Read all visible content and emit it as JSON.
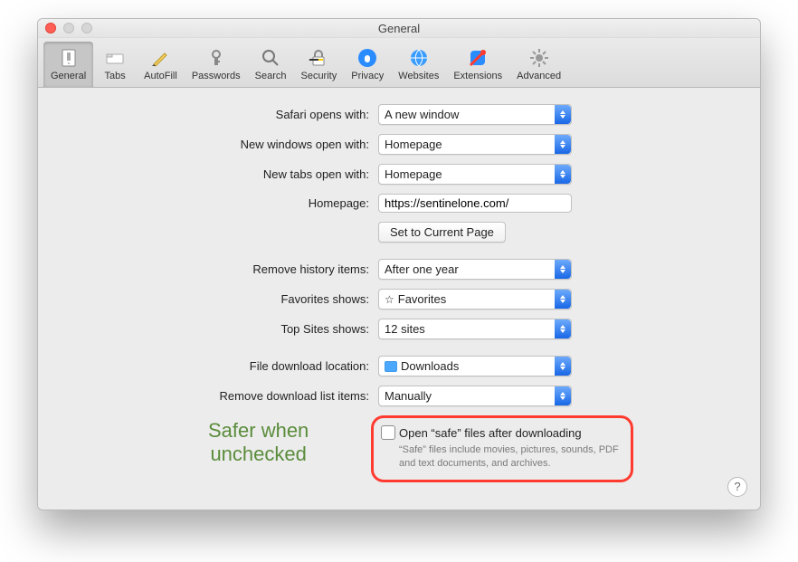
{
  "window": {
    "title": "General"
  },
  "toolbar": {
    "items": [
      {
        "label": "General"
      },
      {
        "label": "Tabs"
      },
      {
        "label": "AutoFill"
      },
      {
        "label": "Passwords"
      },
      {
        "label": "Search"
      },
      {
        "label": "Security"
      },
      {
        "label": "Privacy"
      },
      {
        "label": "Websites"
      },
      {
        "label": "Extensions"
      },
      {
        "label": "Advanced"
      }
    ]
  },
  "labels": {
    "safari_opens_with": "Safari opens with:",
    "new_windows_open_with": "New windows open with:",
    "new_tabs_open_with": "New tabs open with:",
    "homepage": "Homepage:",
    "set_current_page": "Set to Current Page",
    "remove_history": "Remove history items:",
    "favorites_shows": "Favorites shows:",
    "top_sites_shows": "Top Sites shows:",
    "file_download_location": "File download location:",
    "remove_download_items": "Remove download list items:"
  },
  "values": {
    "safari_opens_with": "A new window",
    "new_windows_open_with": "Homepage",
    "new_tabs_open_with": "Homepage",
    "homepage": "https://sentinelone.com/",
    "remove_history": "After one year",
    "favorites_shows": "Favorites",
    "top_sites_shows": "12 sites",
    "file_download_location": "Downloads",
    "remove_download_items": "Manually"
  },
  "safe_files": {
    "checkbox_label": "Open “safe” files after downloading",
    "description": "“Safe” files include movies, pictures, sounds, PDF and text documents, and archives."
  },
  "annotation": {
    "line1": "Safer when",
    "line2": "unchecked"
  },
  "help": "?"
}
